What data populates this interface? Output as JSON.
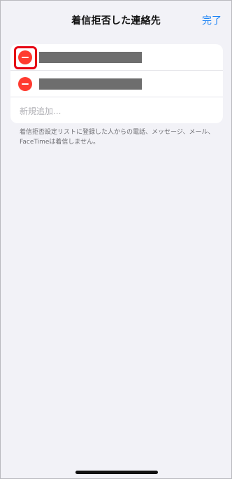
{
  "header": {
    "title": "着信拒否した連絡先",
    "done_label": "完了"
  },
  "blocked_list": {
    "rows": [
      {
        "name": "",
        "name_redacted": true,
        "remove_icon": "minus-circle-icon",
        "highlighted": true
      },
      {
        "name": "",
        "name_redacted": true,
        "remove_icon": "minus-circle-icon",
        "highlighted": false
      }
    ],
    "add_new_label": "新規追加..."
  },
  "footer": {
    "note": "着信拒否設定リストに登録した人からの電話、メッセージ、メール、FaceTimeは着信しません。"
  },
  "colors": {
    "accent": "#1a82f5",
    "destructive": "#ff3b30",
    "highlight": "#e60012",
    "background": "#f2f2f7"
  }
}
